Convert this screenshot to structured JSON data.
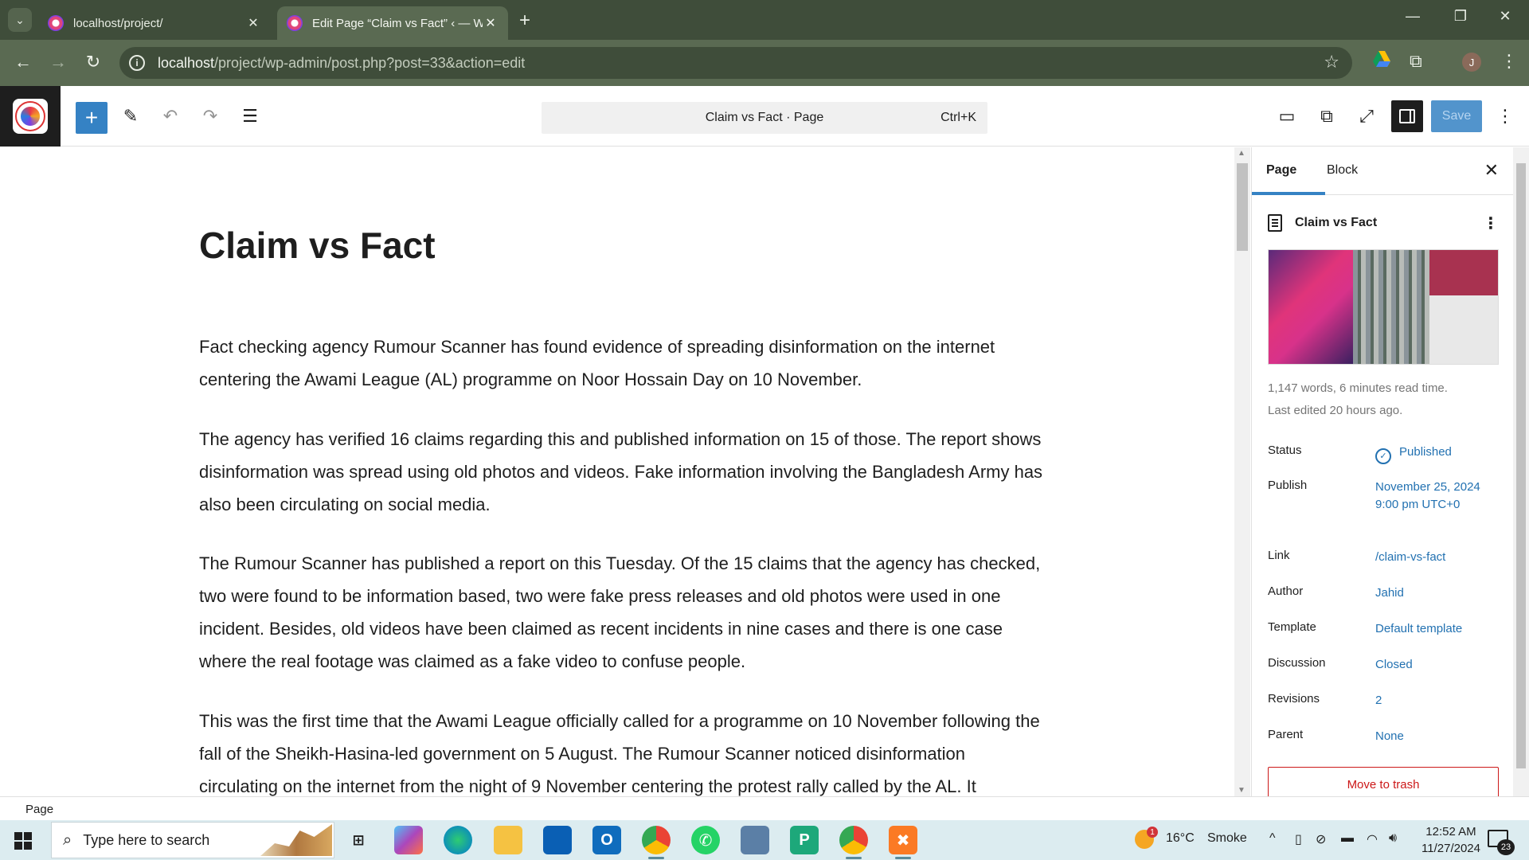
{
  "browser": {
    "tabs": [
      {
        "title": "localhost/project/",
        "active": false
      },
      {
        "title": "Edit Page “Claim vs Fact” ‹ — W",
        "active": true
      }
    ],
    "new_tab_icon": "plus-icon",
    "url_host": "localhost",
    "url_path": "/project/wp-admin/post.php?post=33&action=edit",
    "avatar_initial": "J"
  },
  "toolbar": {
    "command_bar_label": "Claim vs Fact · Page",
    "command_bar_shortcut": "Ctrl+K",
    "save_label": "Save",
    "add_block_symbol": "+"
  },
  "post": {
    "title": "Claim vs Fact",
    "paragraphs": [
      "Fact checking agency Rumour Scanner has found evidence of spreading disinformation on the internet centering the Awami League (AL) programme on Noor Hossain Day on 10 November.",
      "The agency has verified 16 claims regarding this and published information on 15 of those. The report shows disinformation was spread using old photos and videos. Fake information involving the Bangladesh Army has also been circulating on social media.",
      "The Rumour Scanner has published a report on this Tuesday. Of the 15 claims that the agency has checked, two were found to be information based, two were fake press releases and old photos were used in one incident. Besides, old videos have been claimed as recent incidents in nine cases and there is one case where the real footage was claimed as a fake video to confuse people.",
      "This was the first time that the Awami League officially called for a programme on 10 November following the fall of the Sheikh-Hasina-led government on 5 August. The Rumour Scanner noticed disinformation circulating on the internet from the night of 9 November centering the protest rally called by the AL. It"
    ]
  },
  "sidebar": {
    "tabs": [
      "Page",
      "Block"
    ],
    "doc_title": "Claim vs Fact",
    "stats": "1,147 words, 6 minutes read time.",
    "last_edited": "Last edited 20 hours ago.",
    "rows": {
      "status": {
        "label": "Status",
        "value": "Published"
      },
      "publish": {
        "label": "Publish",
        "value": "November 25, 2024 9:00 pm UTC+0"
      },
      "link": {
        "label": "Link",
        "value": "/claim-vs-fact"
      },
      "author": {
        "label": "Author",
        "value": "Jahid"
      },
      "template": {
        "label": "Template",
        "value": "Default template"
      },
      "discussion": {
        "label": "Discussion",
        "value": "Closed"
      },
      "revisions": {
        "label": "Revisions",
        "value": "2"
      },
      "parent": {
        "label": "Parent",
        "value": "None"
      }
    },
    "trash_label": "Move to trash"
  },
  "footer": {
    "breadcrumb": "Page"
  },
  "taskbar": {
    "search_placeholder": "Type here to search",
    "weather_temp": "16°C",
    "weather_desc": "Smoke",
    "weather_alert": "1",
    "time": "12:52 AM",
    "date": "11/27/2024",
    "notification_count": "23"
  },
  "colors": {
    "accent": "#3582c4",
    "link": "#2271b1",
    "danger": "#cc1818",
    "chrome_dark": "#3f4d3a",
    "chrome_mid": "#5a6a52"
  }
}
